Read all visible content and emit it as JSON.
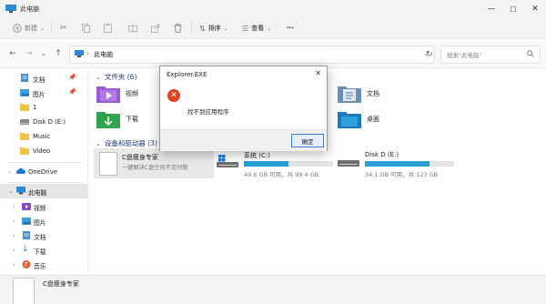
{
  "window": {
    "title": "此电脑"
  },
  "toolbar": {
    "new_label": "新建",
    "sort_label": "排序",
    "view_label": "查看",
    "more_label": "···"
  },
  "address": {
    "path": "此电脑",
    "search_placeholder": "搜索\"此电脑\""
  },
  "sidebar": {
    "quick": [
      {
        "label": "文档",
        "icon": "documents-icon"
      },
      {
        "label": "图片",
        "icon": "pictures-icon"
      },
      {
        "label": "1",
        "icon": "folder-icon"
      },
      {
        "label": "Disk D (E:)",
        "icon": "drive-icon"
      },
      {
        "label": "Music",
        "icon": "folder-icon"
      },
      {
        "label": "Video",
        "icon": "folder-icon"
      }
    ],
    "onedrive": "OneDrive",
    "thispc": "此电脑",
    "pc_children": [
      {
        "label": "视频",
        "icon": "videos-icon"
      },
      {
        "label": "图片",
        "icon": "pictures-icon"
      },
      {
        "label": "文档",
        "icon": "documents-icon"
      },
      {
        "label": "下载",
        "icon": "downloads-icon"
      },
      {
        "label": "音乐",
        "icon": "music-icon"
      }
    ]
  },
  "content": {
    "folders_heading": "文件夹 (6)",
    "folders": [
      {
        "label": "视频",
        "icon": "videos-icon"
      },
      {
        "label": "文档",
        "icon": "documents-icon"
      },
      {
        "label": "下载",
        "icon": "downloads-icon"
      },
      {
        "label": "桌面",
        "icon": "desktop-icon"
      }
    ],
    "devices_heading": "设备和驱动器 (3)",
    "cleaner": {
      "name": "C盘瘦身专家",
      "desc": "一键解决C盘空间不足问题"
    },
    "drives": [
      {
        "name": "系统 (C:)",
        "size": "49.6 GB 可用，共 99.4 GB",
        "used_fraction": 0.5
      },
      {
        "name": "Disk D (E:)",
        "size": "34.1 GB 可用，共 123 GB",
        "used_fraction": 0.72
      }
    ]
  },
  "status": {
    "preview_name": "C盘瘦身专家"
  },
  "dialog": {
    "title": "Explorer.EXE",
    "message": "找不到应用程序",
    "ok_label": "确定"
  },
  "colors": {
    "accent": "#2a9fd6",
    "error": "#e04020",
    "selection": "#e6e6e6"
  }
}
